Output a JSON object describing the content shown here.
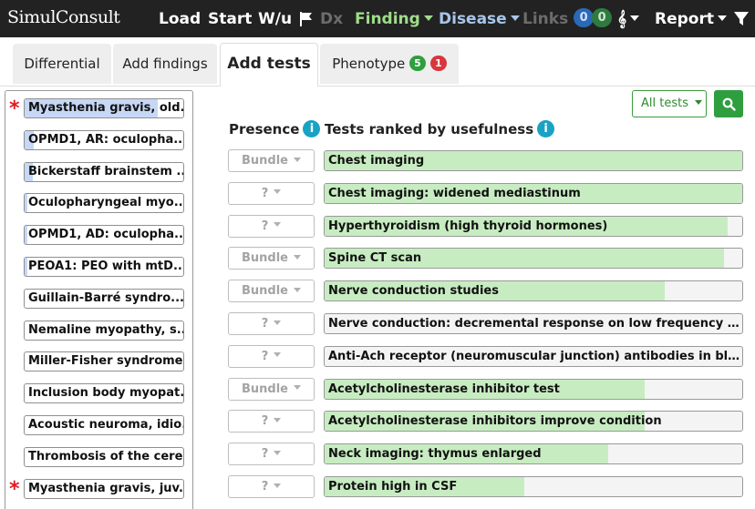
{
  "navbar": {
    "brand": "SimulConsult",
    "load": "Load",
    "start": "Start",
    "wu": "W/u",
    "dx": "Dx",
    "finding": "Finding",
    "disease": "Disease",
    "links": "Links",
    "links_count_blue": "0",
    "links_count_green": "0",
    "dna_glyph": "𝄞",
    "report": "Report",
    "icons": [
      "flag-icon",
      "dna-icon",
      "filter-icon"
    ]
  },
  "tabs": {
    "differential": "Differential",
    "add_findings": "Add findings",
    "add_tests": "Add tests",
    "phenotype": "Phenotype",
    "phenotype_green": "5",
    "phenotype_red": "1"
  },
  "differential": [
    {
      "name": "Myasthenia gravis, old...",
      "starred": true,
      "fill": 0.84
    },
    {
      "name": "OPMD1, AR: oculopha...",
      "starred": false,
      "fill": 0.06
    },
    {
      "name": "Bickerstaff brainstem ...",
      "starred": false,
      "fill": 0.05
    },
    {
      "name": "Oculopharyngeal myo...",
      "starred": false,
      "fill": 0.02
    },
    {
      "name": "OPMD1, AD: oculopha...",
      "starred": false,
      "fill": 0.02
    },
    {
      "name": "PEOA1: PEO with mtD...",
      "starred": false,
      "fill": 0.02
    },
    {
      "name": "Guillain-Barré syndro...",
      "starred": false,
      "fill": 0.0
    },
    {
      "name": "Nemaline myopathy, s...",
      "starred": false,
      "fill": 0.0
    },
    {
      "name": "Miller-Fisher syndrome",
      "starred": false,
      "fill": 0.0
    },
    {
      "name": "Inclusion body myopat...",
      "starred": false,
      "fill": 0.0
    },
    {
      "name": "Acoustic neuroma, idio...",
      "starred": false,
      "fill": 0.0
    },
    {
      "name": "Thrombosis of the cere...",
      "starred": false,
      "fill": 0.0
    },
    {
      "name": "Myasthenia gravis, juv...",
      "starred": true,
      "fill": 0.0
    }
  ],
  "toolbar": {
    "filter_label": "All tests",
    "search_icon": "search-icon"
  },
  "headers": {
    "presence": "Presence",
    "tests": "Tests ranked by usefulness",
    "info_glyph": "i"
  },
  "tests": [
    {
      "presence": "Bundle",
      "name": "Chest imaging",
      "usefulness": 1.0
    },
    {
      "presence": "?",
      "name": "Chest imaging: widened mediastinum",
      "usefulness": 1.0
    },
    {
      "presence": "?",
      "name": "Hyperthyroidism (high thyroid hormones)",
      "usefulness": 0.965
    },
    {
      "presence": "Bundle",
      "name": "Spine CT scan",
      "usefulness": 0.957
    },
    {
      "presence": "Bundle",
      "name": "Nerve conduction studies",
      "usefulness": 0.815
    },
    {
      "presence": "?",
      "name": "Nerve conduction: decremental response on low frequency repet...",
      "usefulness": 0.0
    },
    {
      "presence": "?",
      "name": "Anti-Ach receptor (neuromuscular junction) antibodies in blood",
      "usefulness": 0.0
    },
    {
      "presence": "Bundle",
      "name": "Acetylcholinesterase inhibitor test",
      "usefulness": 0.767
    },
    {
      "presence": "?",
      "name": "Acetylcholinesterase inhibitors improve condition",
      "usefulness": 0.767
    },
    {
      "presence": "?",
      "name": "Neck imaging: thymus enlarged",
      "usefulness": 0.678
    },
    {
      "presence": "?",
      "name": "Protein high in CSF",
      "usefulness": 0.478
    }
  ],
  "colors": {
    "navbar": "#222222",
    "green_text": "#9fdc8a",
    "blue_text": "#a8c6ea",
    "badge_blue": "#2a68b8",
    "badge_green": "#2f7a3f",
    "badge_red": "#d9363e",
    "bar_fill": "#c8ecc2",
    "diff_fill": "#c6d8f5",
    "accent_green": "#2f9e3f"
  }
}
